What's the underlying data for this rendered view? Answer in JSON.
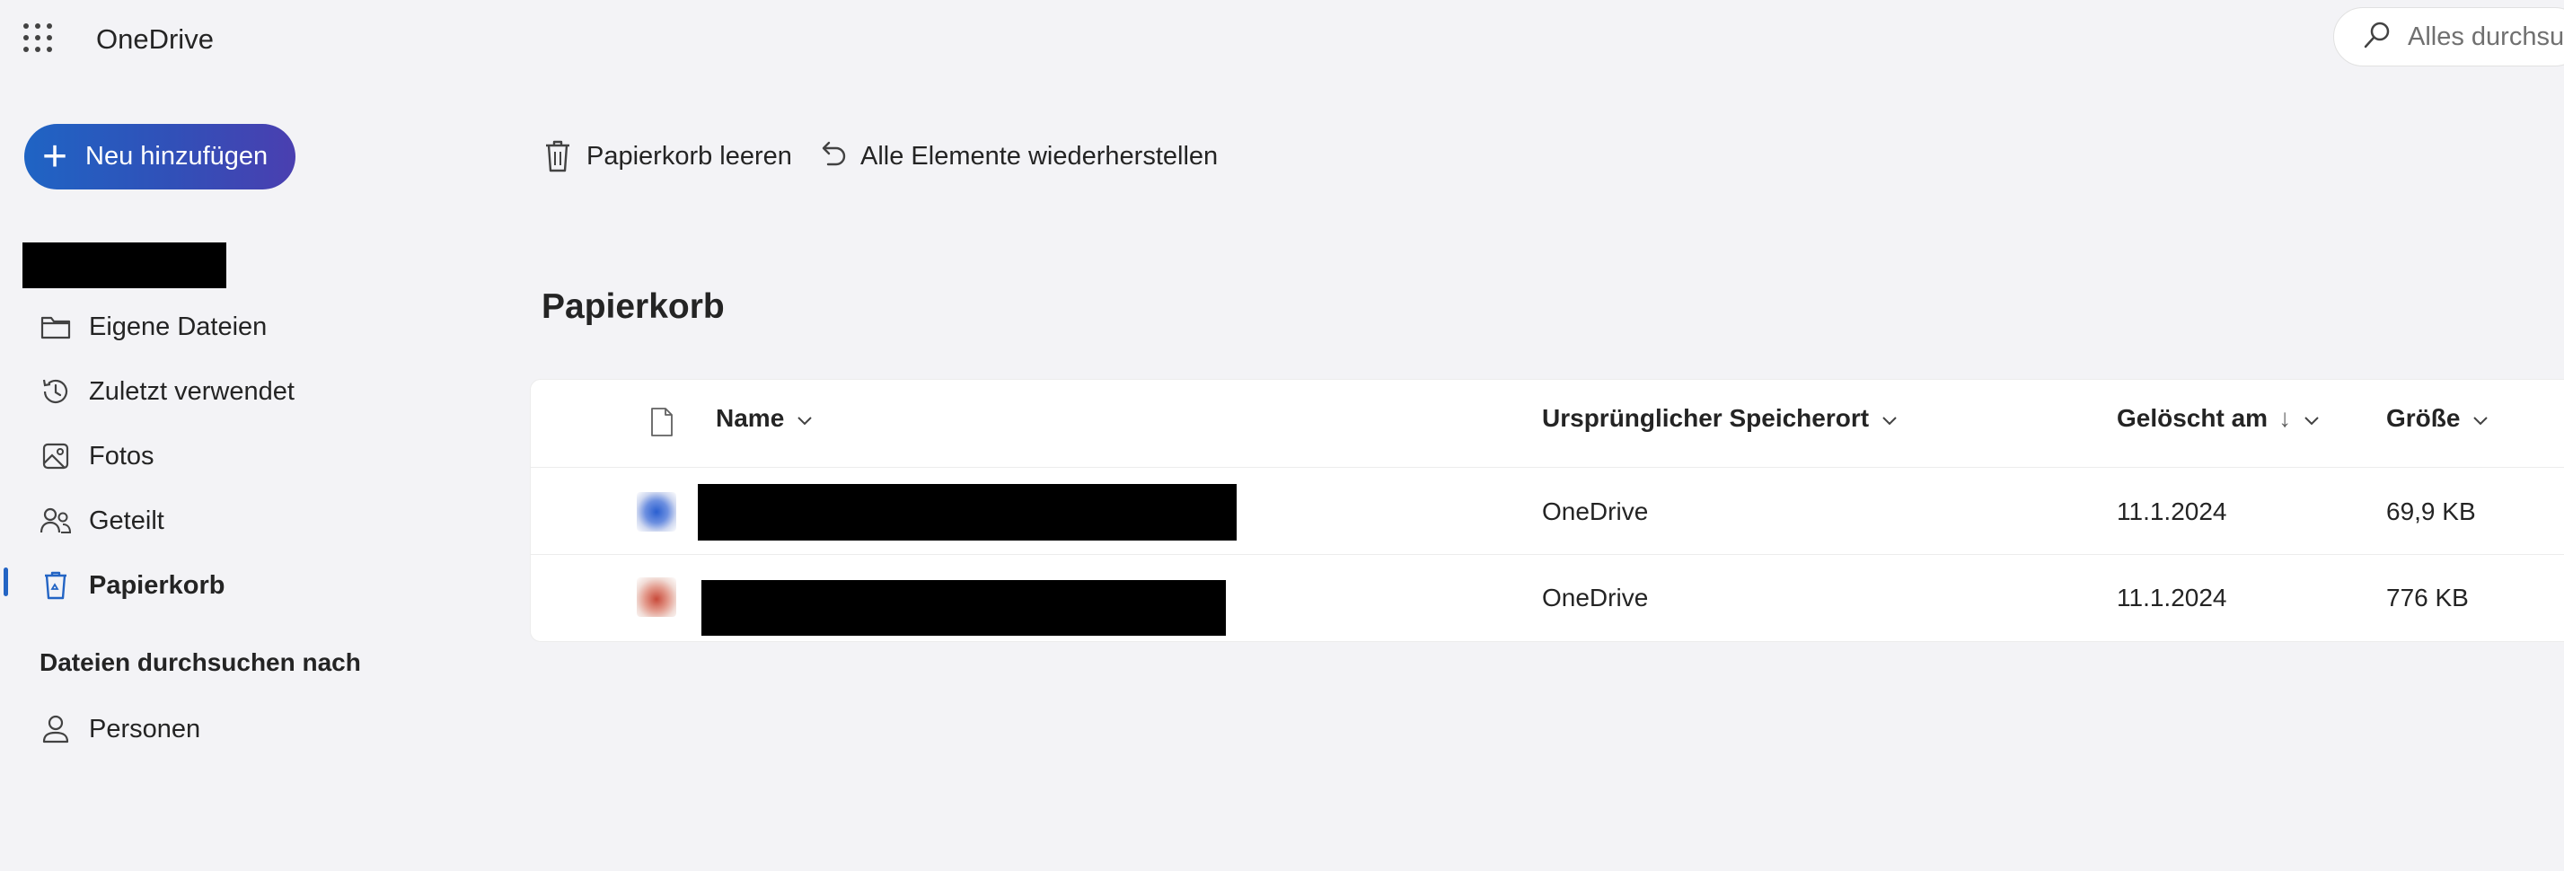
{
  "app": {
    "title": "OneDrive"
  },
  "search": {
    "placeholder": "Alles durchsuchen"
  },
  "new_button": {
    "label": "Neu hinzufügen"
  },
  "sidebar": {
    "items": [
      {
        "label": "Eigene Dateien",
        "icon": "folder-icon"
      },
      {
        "label": "Zuletzt verwendet",
        "icon": "recent-icon"
      },
      {
        "label": "Fotos",
        "icon": "photo-icon"
      },
      {
        "label": "Geteilt",
        "icon": "shared-icon"
      },
      {
        "label": "Papierkorb",
        "icon": "recycle-bin-icon",
        "active": true
      }
    ],
    "section_title": "Dateien durchsuchen nach",
    "section_items": [
      {
        "label": "Personen",
        "icon": "person-icon"
      }
    ]
  },
  "toolbar": {
    "empty_label": "Papierkorb leeren",
    "restore_label": "Alle Elemente wiederherstellen"
  },
  "page": {
    "title": "Papierkorb"
  },
  "table": {
    "columns": [
      "Name",
      "Ursprünglicher Speicherort",
      "Gelöscht am",
      "Größe"
    ],
    "sort_indicator": "↓",
    "rows": [
      {
        "location": "OneDrive",
        "deleted": "11.1.2024",
        "size": "69,9 KB"
      },
      {
        "location": "OneDrive",
        "deleted": "11.1.2024",
        "size": "776 KB"
      }
    ]
  },
  "colors": {
    "accent": "#2364c4",
    "button_gradient_start": "#1f64c4",
    "button_gradient_end": "#4a3fb0",
    "background": "#f3f3f6"
  }
}
